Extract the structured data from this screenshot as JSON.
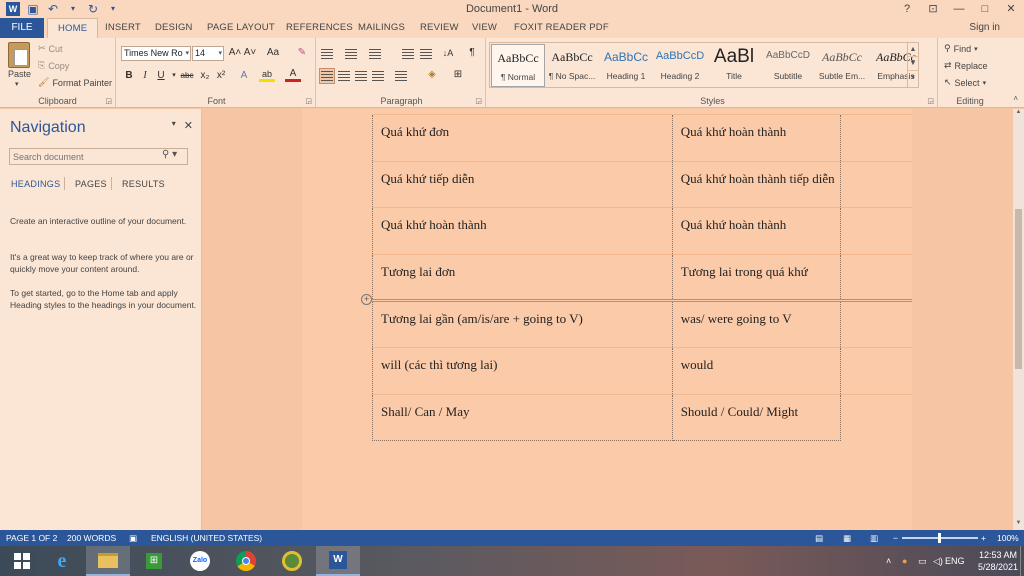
{
  "window": {
    "title": "Document1 - Word",
    "help": "?",
    "controls": [
      "—",
      "□",
      "✕"
    ]
  },
  "ribbon_tabs": {
    "file": "FILE",
    "tabs": [
      "HOME",
      "INSERT",
      "DESIGN",
      "PAGE LAYOUT",
      "REFERENCES",
      "MAILINGS",
      "REVIEW",
      "VIEW",
      "FOXIT READER PDF"
    ],
    "active": "HOME",
    "sign_in": "Sign in"
  },
  "clipboard": {
    "paste": "Paste",
    "cut": "Cut",
    "copy": "Copy",
    "format_painter": "Format Painter",
    "label": "Clipboard"
  },
  "font": {
    "family": "Times New Ro",
    "size": "14",
    "label": "Font",
    "bold": "B",
    "italic": "I",
    "underline": "U",
    "strike": "abc",
    "subscript": "x₂",
    "superscript": "x²",
    "grow": "A˄",
    "shrink": "A˅",
    "case": "Aa",
    "effects": "A",
    "highlight": "ab",
    "color": "A"
  },
  "paragraph": {
    "label": "Paragraph",
    "pilcrow": "¶",
    "sort": "↓A"
  },
  "styles": {
    "label": "Styles",
    "items": [
      {
        "preview": "AaBbCc",
        "name": "¶ Normal"
      },
      {
        "preview": "AaBbCc",
        "name": "¶ No Spac..."
      },
      {
        "preview": "AaBbCc",
        "name": "Heading 1"
      },
      {
        "preview": "AaBbCcD",
        "name": "Heading 2"
      },
      {
        "preview": "AaBl",
        "name": "Title"
      },
      {
        "preview": "AaBbCcD",
        "name": "Subtitle"
      },
      {
        "preview": "AaBbCc",
        "name": "Subtle Em..."
      },
      {
        "preview": "AaBbCc",
        "name": "Emphasis"
      }
    ]
  },
  "editing": {
    "label": "Editing",
    "find": "Find",
    "replace": "Replace",
    "select": "Select"
  },
  "navigation": {
    "title": "Navigation",
    "search_placeholder": "Search document",
    "tabs": [
      "HEADINGS",
      "PAGES",
      "RESULTS"
    ],
    "help1": "Create an interactive outline of your document.",
    "help2": "It's a great way to keep track of where you are or quickly move your content around.",
    "help3": "To get started, go to the Home tab and apply Heading styles to the headings in your document."
  },
  "table": {
    "rows": [
      [
        "Quá khứ đơn",
        "Quá khứ hoàn thành"
      ],
      [
        "Quá khứ tiếp diễn",
        "Quá khứ hoàn thành tiếp diễn"
      ],
      [
        "Quá khứ hoàn thành",
        "Quá khứ hoàn thành"
      ],
      [
        "Tương lai đơn",
        "Tương lai trong quá khứ"
      ],
      [
        "Tương lai gần (am/is/are + going to V)",
        "was/ were going to V"
      ],
      [
        "will (các thì tương lai)",
        "would"
      ],
      [
        "Shall/ Can / May",
        "Should / Could/ Might"
      ]
    ]
  },
  "status": {
    "page": "PAGE 1 OF 2",
    "words": "200 WORDS",
    "language": "ENGLISH (UNITED STATES)",
    "zoom": "100%",
    "zoom_fraction": 0.47,
    "minus": "−",
    "plus": "+"
  },
  "taskbar": {
    "lang": "ENG",
    "time": "12:53 AM",
    "date": "5/28/2021",
    "zalo": "Zalo"
  },
  "colors": {
    "brand": "#2b579a",
    "page_tint": "#fbcaa8"
  }
}
